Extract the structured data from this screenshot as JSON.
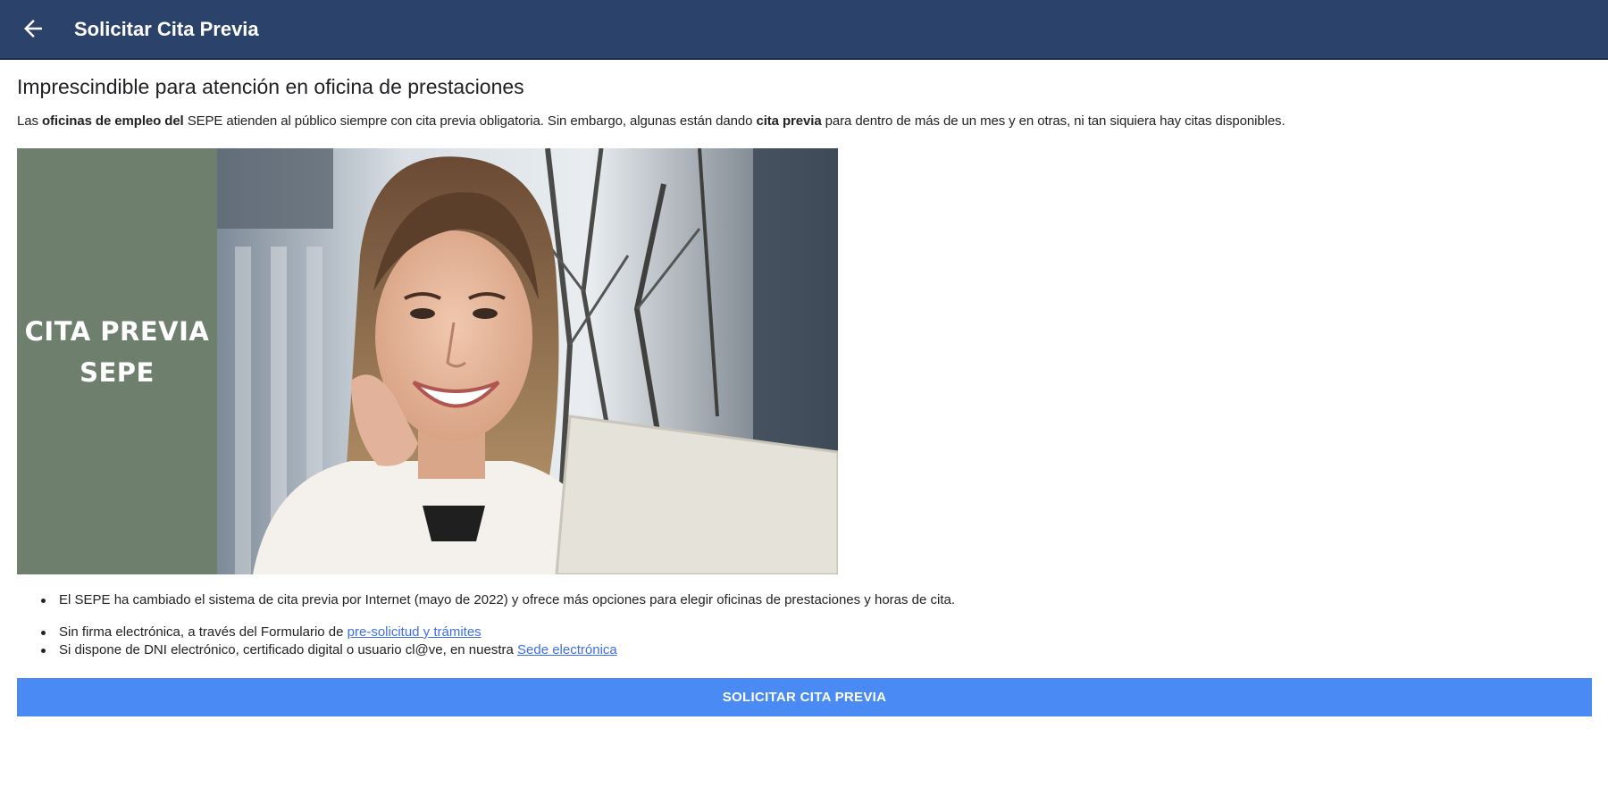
{
  "appbar": {
    "title": "Solicitar Cita Previa",
    "back_icon": "arrow-left-icon",
    "color": "#2b426b"
  },
  "main": {
    "heading": "Imprescindible para atención en oficina de prestaciones",
    "intro": {
      "part1": "Las ",
      "bold1": "oficinas de empleo del",
      "part2": " SEPE atienden al público siempre con cita previa obligatoria. Sin embargo, algunas están dando ",
      "bold2": "cita previa",
      "part3": " para dentro de más de un mes y en otras, ni tan siquiera hay citas disponibles."
    },
    "hero": {
      "line1": "CITA PREVIA",
      "line2": "SEPE",
      "panel_color": "#6e7f6e"
    },
    "bullets": [
      {
        "text": "El SEPE ha cambiado el sistema de cita previa por Internet (mayo de 2022) y ofrece más opciones para elegir oficinas de prestaciones y horas de cita."
      },
      {
        "text": "Sin firma electrónica, a través del Formulario de ",
        "link": "pre-solicitud y trámites"
      },
      {
        "text": "Si dispone de DNI electrónico, certificado digital o usuario cl@ve, en nuestra ",
        "link": "Sede electrónica"
      }
    ],
    "cta_label": "SOLICITAR CITA PREVIA",
    "cta_color": "#4a8af4",
    "link_color": "#3f6fe6"
  }
}
